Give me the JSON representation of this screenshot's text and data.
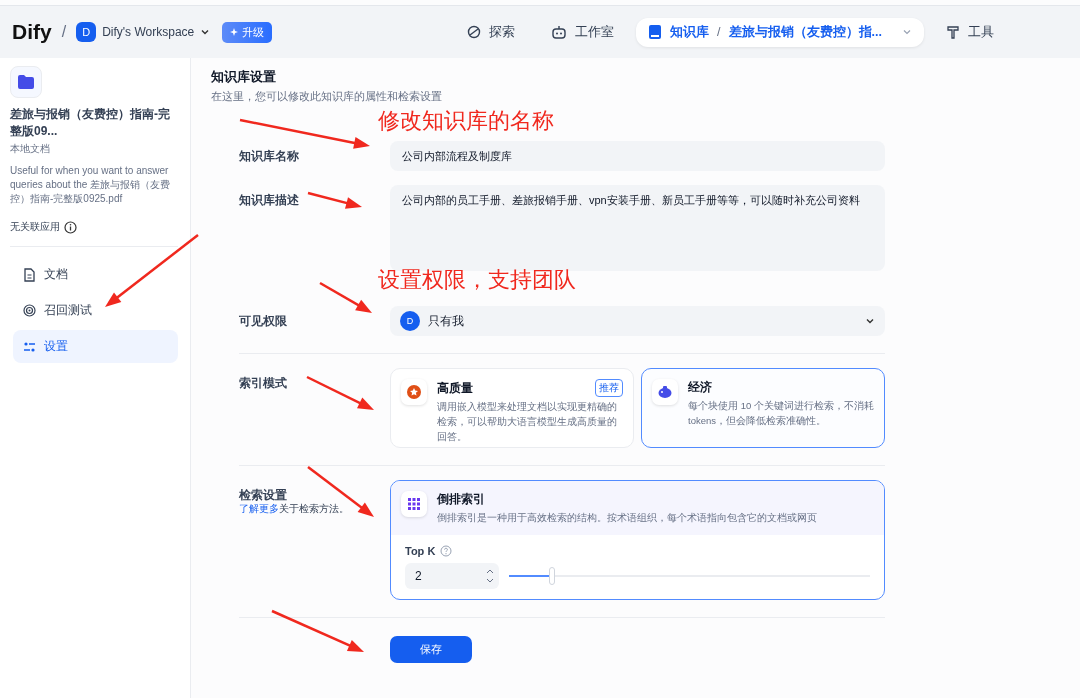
{
  "topbar": {
    "logo": "Dify",
    "separator": "/",
    "workspace": {
      "avatar": "D",
      "name": "Dify's Workspace"
    },
    "upgrade": "升级",
    "nav": [
      {
        "label": "探索",
        "kind": "explore",
        "selected": false
      },
      {
        "label": "工作室",
        "kind": "studio",
        "selected": false
      },
      {
        "label": "知识库",
        "kind": "knowledge",
        "selected": true,
        "crumb_separator": "/",
        "crumb": "差旅与报销（友费控）指..."
      },
      {
        "label": "工具",
        "kind": "tools",
        "selected": false
      }
    ]
  },
  "sidebar": {
    "title": "差旅与报销（友费控）指南-完整版09...",
    "source": "本地文档",
    "description": "Useful for when you want to answer queries about the 差旅与报销（友费控）指南-完整版0925.pdf",
    "linked": "无关联应用",
    "items": [
      {
        "label": "文档",
        "kind": "doc",
        "selected": false
      },
      {
        "label": "召回测试",
        "kind": "test",
        "selected": false
      },
      {
        "label": "设置",
        "kind": "settings",
        "selected": true
      }
    ]
  },
  "page": {
    "title": "知识库设置",
    "subtitle": "在这里，您可以修改此知识库的属性和检索设置",
    "name": {
      "label": "知识库名称",
      "value": "公司内部流程及制度库"
    },
    "description": {
      "label": "知识库描述",
      "value": "公司内部的员工手册、差旅报销手册、vpn安装手册、新员工手册等等，可以随时补充公司资料"
    },
    "permission": {
      "label": "可见权限",
      "avatar": "D",
      "value": "只有我"
    },
    "index_mode": {
      "label": "索引模式",
      "options": [
        {
          "title": "高质量",
          "kind": "quality",
          "badge": "推荐",
          "desc": "调用嵌入模型来处理文档以实现更精确的检索，可以帮助大语言模型生成高质量的回答。",
          "selected": false
        },
        {
          "title": "经济",
          "kind": "economy",
          "desc": "每个块使用 10 个关键词进行检索，不消耗 tokens，但会降低检索准确性。",
          "selected": true
        }
      ]
    },
    "retrieval": {
      "label": "检索设置",
      "link": "了解更多",
      "link_rest": "关于检索方法。",
      "method": {
        "title": "倒排索引",
        "desc": "倒排索引是一种用于高效检索的结构。按术语组织，每个术语指向包含它的文档或网页",
        "selected": true
      },
      "topk": {
        "label": "Top K",
        "value": "2",
        "level": 0.12
      }
    },
    "save": "保存"
  },
  "annotations": [
    "修改知识库的名称",
    "设置权限，支持团队"
  ]
}
